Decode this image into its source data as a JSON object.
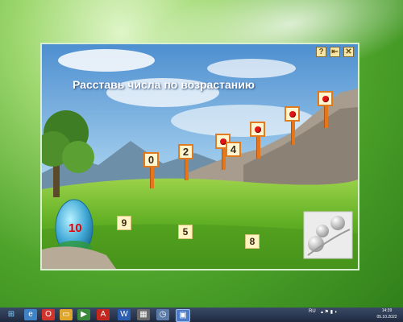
{
  "game": {
    "instruction": "Расставь числа по возрастанию",
    "counter": "10",
    "placed_signs": [
      "0",
      "2",
      "4"
    ],
    "empty_sign_count": 4,
    "tiles": [
      "9",
      "5",
      "8"
    ],
    "controls": {
      "help": "?",
      "home": "⇤",
      "close": "✕"
    }
  },
  "taskbar": {
    "lang": "RU",
    "time": "14:39",
    "date": "05.10.2022",
    "apps": [
      "start",
      "ie",
      "opera",
      "explorer",
      "media-player",
      "pdf",
      "word",
      "media",
      "clock",
      "window"
    ]
  },
  "colors": {
    "sign_border": "#e07b1f",
    "pole": "#e6761a",
    "tile_bg": "#fff4c4",
    "dot": "#e01616",
    "counter": "#e60000"
  }
}
